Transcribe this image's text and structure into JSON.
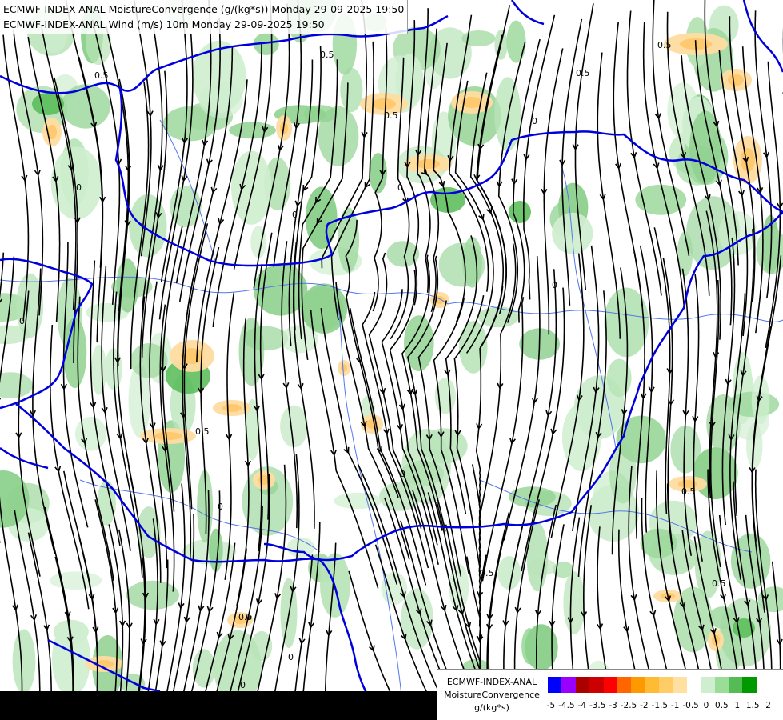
{
  "titles": {
    "line1": "ECMWF-INDEX-ANAL MoistureConvergence (g/(kg*s)) Monday 29-09-2025 19:50",
    "line2": "ECMWF-INDEX-ANAL Wind (m/s) 10m Monday 29-09-2025 19:50"
  },
  "legend": {
    "line1": "ECMWF-INDEX-ANAL",
    "line2": "MoistureConvergence",
    "line3": "g/(kg*s)",
    "ticks": [
      "-5",
      "-4.5",
      "-4",
      "-3.5",
      "-3",
      "-2.5",
      "-2",
      "-1.5",
      "-1",
      "-0.5",
      "0",
      "0.5",
      "1",
      "1.5",
      "2"
    ],
    "colors": [
      "#0000ff",
      "#9900ff",
      "#aa0000",
      "#cc0000",
      "#ff0000",
      "#ff6600",
      "#ff9900",
      "#ffbb33",
      "#ffcc66",
      "#ffe0a0",
      "#ffffff",
      "#cfeecf",
      "#99dd99",
      "#55bb55",
      "#009900"
    ]
  },
  "contour_labels": [
    "0.5",
    "0.5",
    "0.5",
    "0.5",
    "0",
    "0",
    "0",
    "0",
    "0",
    "0.5",
    "0.5",
    "0",
    "0",
    "0.5",
    "0.5",
    "0",
    "0",
    "0.5",
    "0.5",
    "0"
  ]
}
